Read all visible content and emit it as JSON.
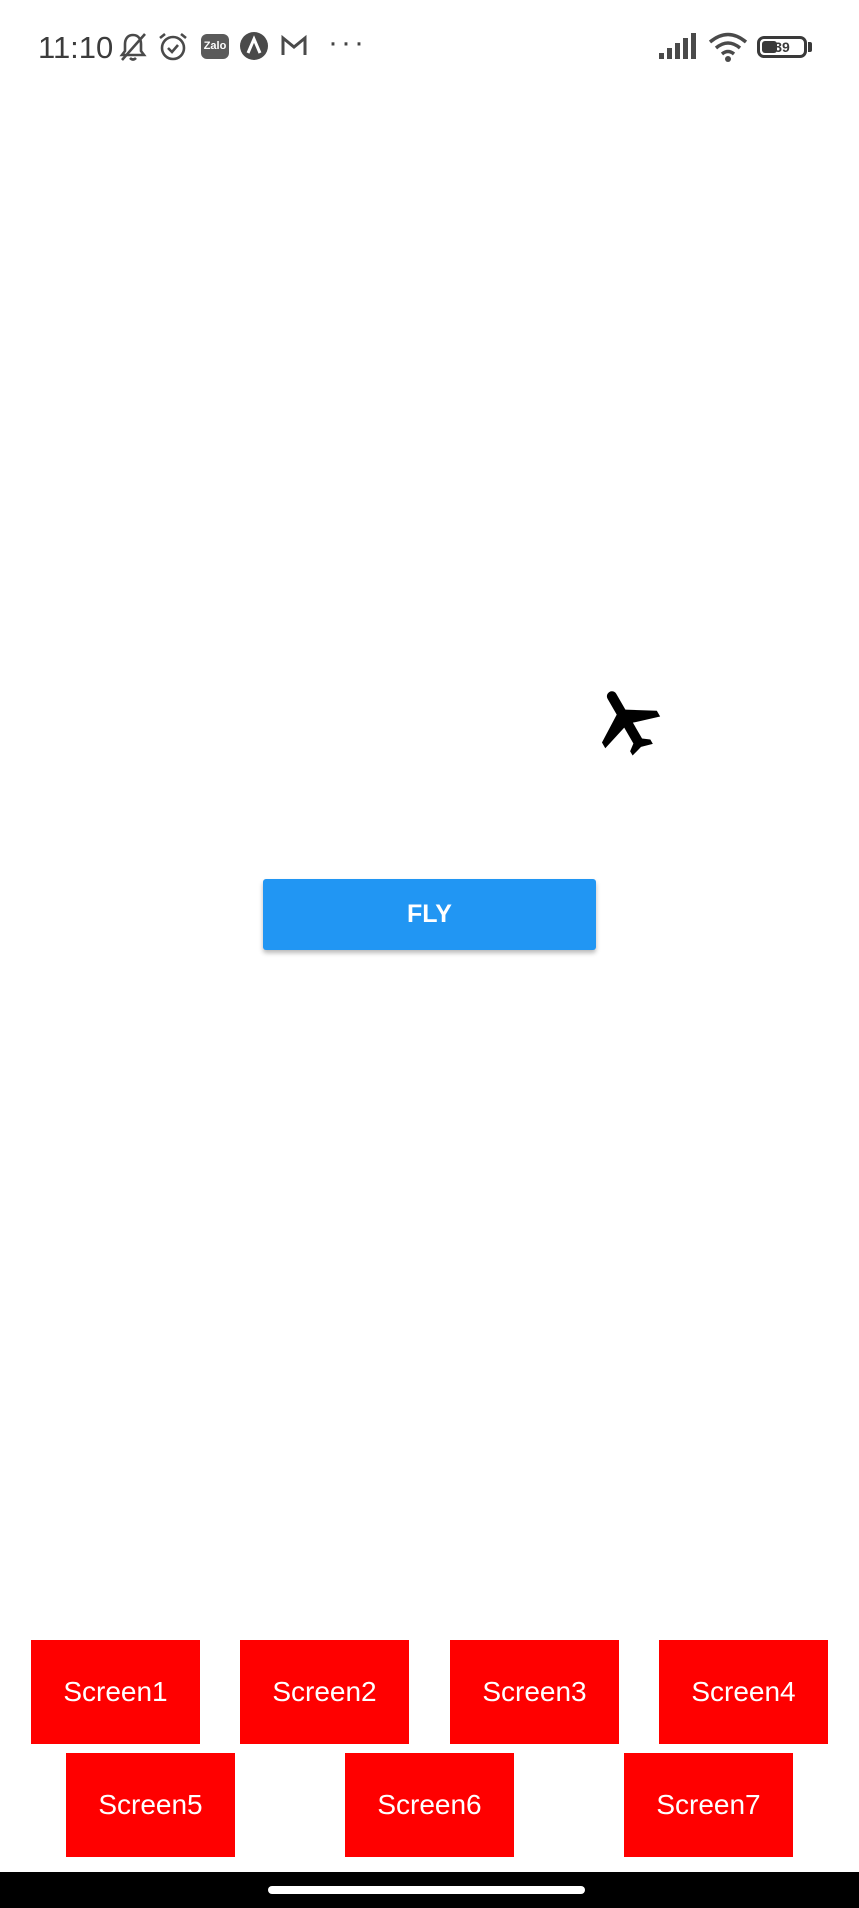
{
  "status_bar": {
    "time": "11:10",
    "zalo_label": "Zalo",
    "more_indicator": "···",
    "battery_level": "39",
    "icons": [
      "bell-off-icon",
      "alarm-icon",
      "zalo-icon",
      "a-app-icon",
      "gmail-icon",
      "signal-icon",
      "wifi-icon",
      "battery-icon"
    ]
  },
  "main": {
    "plane_icon": "airplane-icon",
    "fly_button_label": "FLY"
  },
  "screens": {
    "row1": [
      "Screen1",
      "Screen2",
      "Screen3",
      "Screen4"
    ],
    "row2": [
      "Screen5",
      "Screen6",
      "Screen7"
    ],
    "button_color": "#ff0000"
  },
  "colors": {
    "fly_button": "#2196F3",
    "background": "#ffffff"
  }
}
